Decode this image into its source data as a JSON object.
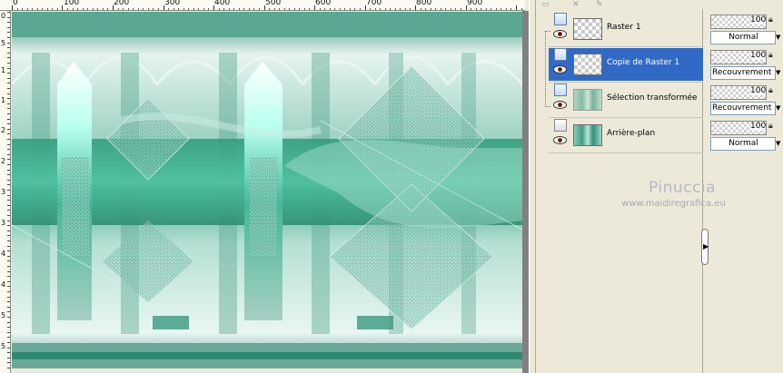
{
  "ruler": {
    "top_labels": [
      "0",
      "100",
      "200",
      "300",
      "400",
      "500",
      "600",
      "700",
      "800",
      "900"
    ],
    "left_labels": [
      "0",
      "5",
      "1",
      "1",
      "2",
      "2",
      "3",
      "3",
      "4",
      "4",
      "5",
      "5"
    ]
  },
  "layers_panel": {
    "layers": [
      {
        "name": "Raster 1",
        "opacity": "100",
        "blend_mode": "Normal",
        "selected": false
      },
      {
        "name": "Copie de Raster 1",
        "opacity": "100",
        "blend_mode": "Recouvrement",
        "selected": true
      },
      {
        "name": "Sélection transformée",
        "opacity": "100",
        "blend_mode": "Recouvrement",
        "selected": false
      },
      {
        "name": "Arrière-plan",
        "opacity": "100",
        "blend_mode": "Normal",
        "selected": false
      }
    ],
    "toolbar_icons": [
      "new-layer-icon",
      "delete-layer-icon",
      "edit-icon"
    ]
  },
  "watermark": {
    "name": "Pinuccia",
    "url": "www.maidiregrafica.eu"
  },
  "colors": {
    "canvas_teal": "#3fa88c",
    "selection_blue": "#316ac5",
    "panel_bg": "#ece9d8"
  }
}
